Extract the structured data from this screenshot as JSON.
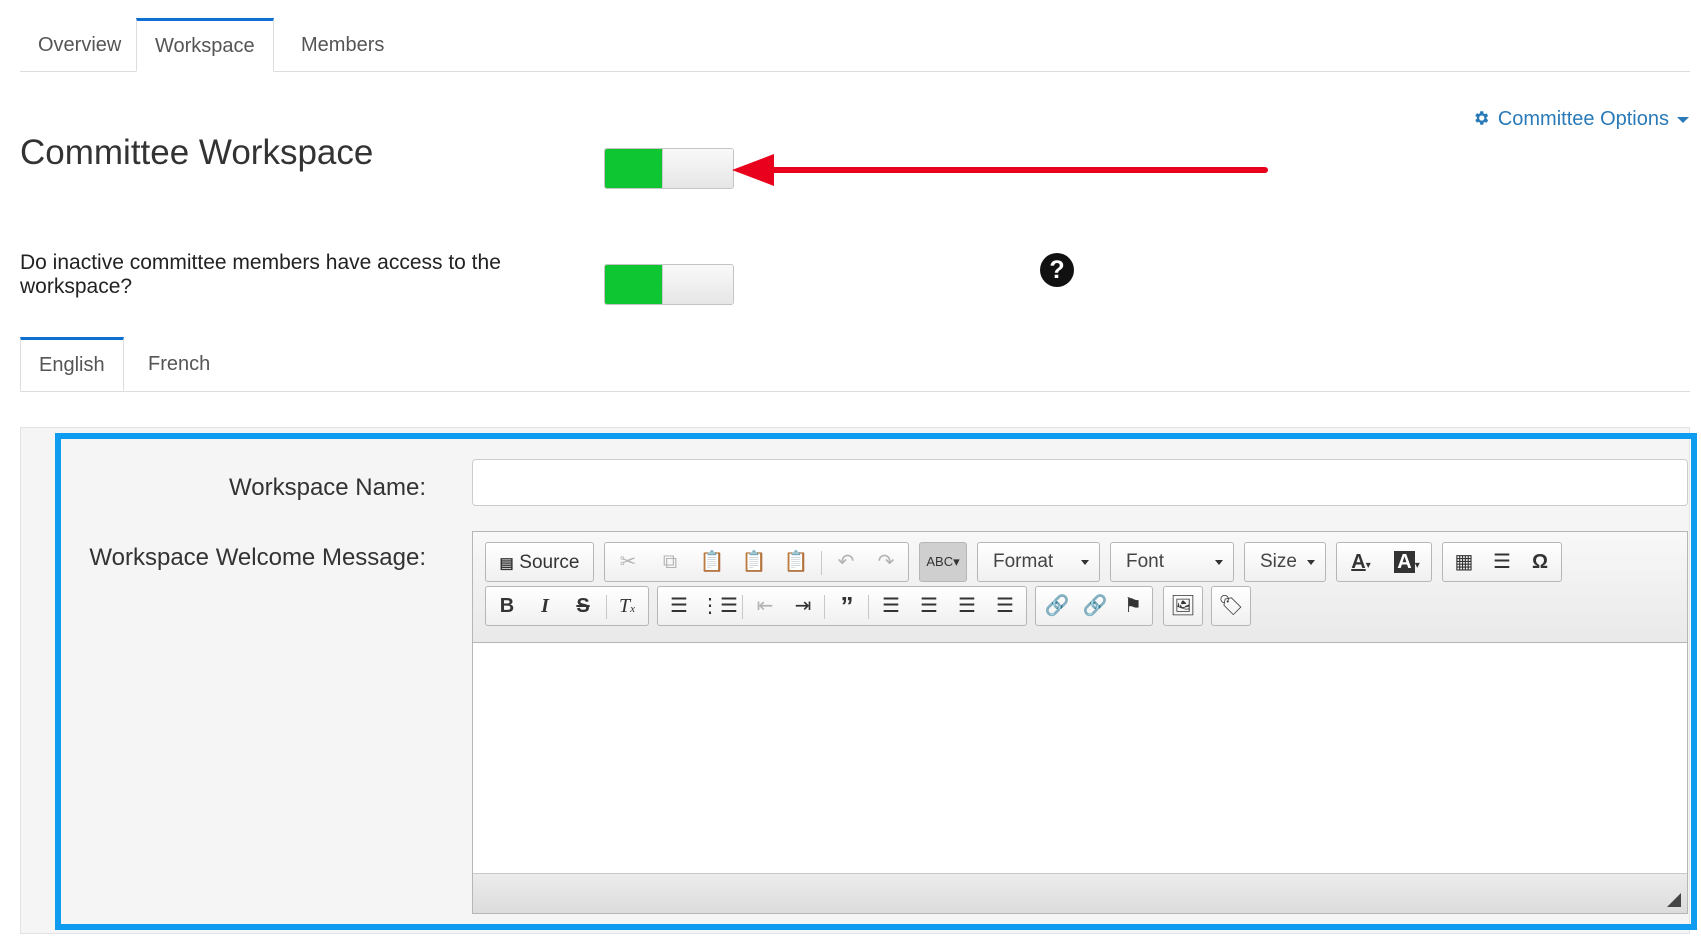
{
  "tabs": {
    "overview": "Overview",
    "workspace": "Workspace",
    "members": "Members"
  },
  "page_title": "Committee Workspace",
  "options_label": "Committee Options",
  "workspace_toggle": {
    "state": "on"
  },
  "inactive_question": "Do inactive committee members have access to the workspace?",
  "inactive_toggle": {
    "state": "on"
  },
  "help_icon": "?",
  "lang_tabs": {
    "english": "English",
    "french": "French"
  },
  "form": {
    "name_label": "Workspace Name:",
    "name_value": "",
    "welcome_label": "Workspace Welcome Message:"
  },
  "editor": {
    "source_label": "Source",
    "format_label": "Format",
    "font_label": "Font",
    "size_label": "Size",
    "body_text": ""
  },
  "colors": {
    "accent": "#0c6fd1",
    "toggle_on": "#0ec631",
    "highlight": "#0d9cf0",
    "arrow": "#e8001c",
    "link": "#2a7ab8"
  }
}
